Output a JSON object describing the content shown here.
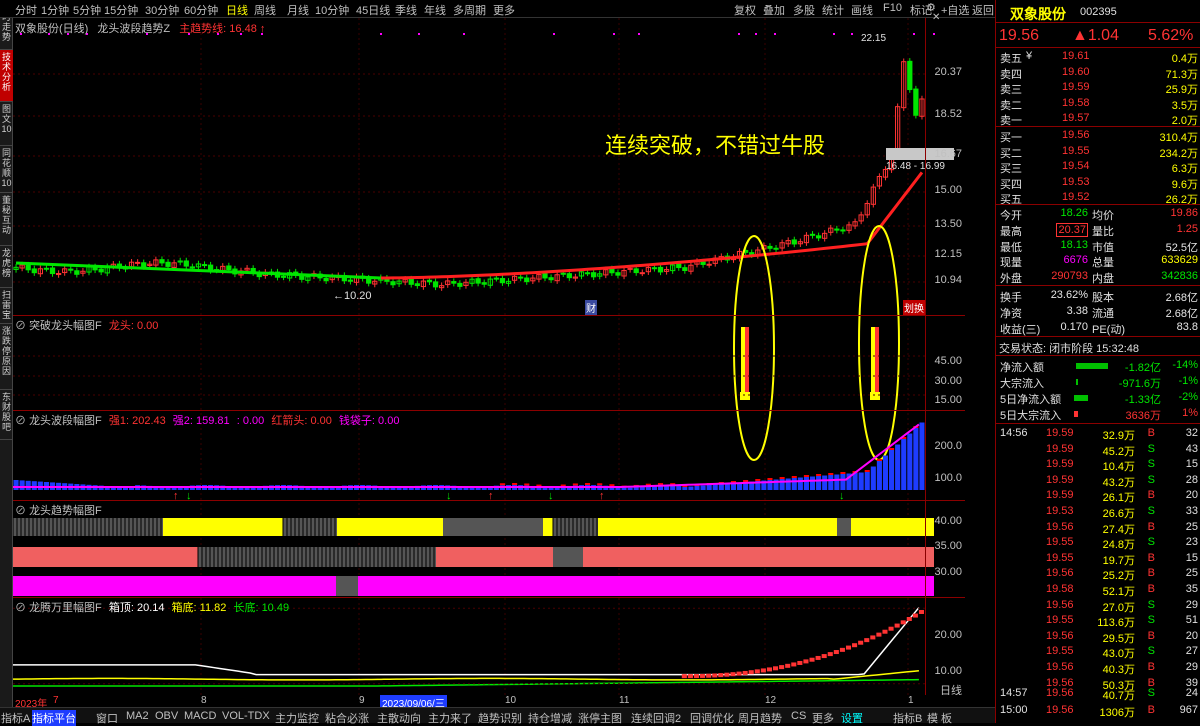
{
  "toolbar": {
    "periods": [
      "分时",
      "1分钟",
      "5分钟",
      "15分钟",
      "30分钟",
      "60分钟",
      "日线",
      "周线",
      "月线",
      "10分钟",
      "45日线",
      "季线",
      "年线",
      "多周期",
      "更多"
    ],
    "active_period": "日线",
    "right_tools": [
      "复权",
      "叠加",
      "多股",
      "统计",
      "画线",
      "F10",
      "标记"
    ],
    "self_select": "+自选",
    "back": "返回",
    "settings_icon": "gear-icon",
    "close_icon": "close-icon"
  },
  "leftnav": [
    "分时走势",
    "技术分析",
    "图文10",
    "同花顺10",
    "董秘互动",
    "龙虎榜",
    "扫雷宝",
    "涨跌停原因",
    "东财股吧"
  ],
  "leftnav_active": "技术分析",
  "main_pane": {
    "stock": "双象股份(日线)",
    "indicator": "龙头波段趋势Z",
    "trend_label": "主趋势线: 16.48",
    "annotation": "连续突破，不错过牛股",
    "high_label": "22.15",
    "low_label": "10.20",
    "range_label": "16.48 - 16.99",
    "axis": [
      "20.37",
      "18.52",
      "16.67",
      "15.00",
      "13.50",
      "12.15",
      "10.94"
    ],
    "marker_cai": "财",
    "marker_huan": "划换"
  },
  "pane2": {
    "name": "突破龙头幅图F",
    "label": "龙头: 0.00",
    "axis": [
      "45.00",
      "30.00",
      "15.00"
    ]
  },
  "pane3": {
    "name": "龙头波段幅图F",
    "q1": "强1: 202.43",
    "q2": "强2: 159.81",
    "colon": ": 0.00",
    "red_arrow": "红箭头: 0.00",
    "money_bag": "钱袋子: 0.00",
    "axis": [
      "200.0",
      "100.0"
    ]
  },
  "pane4": {
    "name": "龙头趋势幅图F",
    "axis": [
      "40.00",
      "35.00",
      "30.00"
    ]
  },
  "pane5": {
    "name": "龙腾万里幅图F",
    "top": "箱顶: 20.14",
    "bottom": "箱底: 11.82",
    "changdi": "长底: 10.49",
    "axis": [
      "20.00",
      "10.00"
    ],
    "axis_label": "日线"
  },
  "datebar": [
    {
      "text": "2023年",
      "color": "#ff3333"
    },
    {
      "text": "7",
      "color": "#ff3333"
    },
    {
      "text": "8",
      "color": "#c0c0c0"
    },
    {
      "text": "9",
      "color": "#c0c0c0"
    },
    {
      "text": "2023/09/06/三",
      "color": "#ffffff"
    },
    {
      "text": "10",
      "color": "#c0c0c0"
    },
    {
      "text": "11",
      "color": "#c0c0c0"
    },
    {
      "text": "12",
      "color": "#c0c0c0"
    },
    {
      "text": "1",
      "color": "#c0c0c0"
    }
  ],
  "bottombar": [
    "指标A",
    "指标平台",
    "窗口",
    "MA2",
    "OBV",
    "MACD",
    "VOL-TDX",
    "主力监控",
    "粘合必涨",
    "主散动向",
    "主力来了",
    "趋势识别",
    "持仓增减",
    "涨停主图",
    "连续回调2",
    "回调优化",
    "周月趋势",
    "CS",
    "更多",
    "设置"
  ],
  "bottombar_right": [
    "指标B",
    "模",
    "板"
  ],
  "quote": {
    "name": "双象股份",
    "code": "002395",
    "price": "19.56",
    "change": "▲1.04",
    "pct": "5.62%",
    "asks": [
      {
        "label": "卖五",
        "price": "19.61",
        "vol": "0.4万"
      },
      {
        "label": "卖四",
        "price": "19.60",
        "vol": "71.3万"
      },
      {
        "label": "卖三",
        "price": "19.59",
        "vol": "25.9万"
      },
      {
        "label": "卖二",
        "price": "19.58",
        "vol": "3.5万"
      },
      {
        "label": "卖一",
        "price": "19.57",
        "vol": "2.0万"
      }
    ],
    "ask_icon": "¥",
    "bids": [
      {
        "label": "买一",
        "price": "19.56",
        "vol": "310.4万"
      },
      {
        "label": "买二",
        "price": "19.55",
        "vol": "234.2万"
      },
      {
        "label": "买三",
        "price": "19.54",
        "vol": "6.3万"
      },
      {
        "label": "买四",
        "price": "19.53",
        "vol": "9.6万"
      },
      {
        "label": "买五",
        "price": "19.52",
        "vol": "26.2万"
      }
    ],
    "stats": [
      {
        "l1": "今开",
        "v1": "18.26",
        "c1": "green",
        "l2": "均价",
        "v2": "19.86",
        "c2": "red"
      },
      {
        "l1": "最高",
        "v1": "20.37",
        "c1": "red",
        "l2": "量比",
        "v2": "1.25",
        "c2": "red"
      },
      {
        "l1": "最低",
        "v1": "18.13",
        "c1": "green",
        "l2": "市值",
        "v2": "52.5亿",
        "c2": "white"
      },
      {
        "l1": "现量",
        "v1": "6676",
        "c1": "magenta",
        "l2": "总量",
        "v2": "633629",
        "c2": "yellow"
      },
      {
        "l1": "外盘",
        "v1": "290793",
        "c1": "red",
        "l2": "内盘",
        "v2": "342836",
        "c2": "green"
      }
    ],
    "stats2": [
      {
        "l1": "换手",
        "v1": "23.62%",
        "l2": "股本",
        "v2": "2.68亿"
      },
      {
        "l1": "净资",
        "v1": "3.38",
        "l2": "流通",
        "v2": "2.68亿"
      },
      {
        "l1": "收益(三)",
        "v1": "0.170",
        "l2": "PE(动)",
        "v2": "83.8"
      }
    ],
    "trade_status": "交易状态: 闭市阶段 15:32:48",
    "flows": [
      {
        "l": "净流入额",
        "v": "-1.82亿",
        "p": "-14%",
        "c": "green"
      },
      {
        "l": "大宗流入",
        "v": "-971.6万",
        "p": "-1%",
        "c": "green"
      },
      {
        "l": "5日净流入额",
        "v": "-1.33亿",
        "p": "-2%",
        "c": "green"
      },
      {
        "l": "5日大宗流入",
        "v": "3636万",
        "p": "1%",
        "c": "red"
      }
    ],
    "ticks": [
      {
        "t": "14:56",
        "p": "19.59",
        "v": "32.9万",
        "s": "B",
        "n": "32"
      },
      {
        "t": "",
        "p": "19.59",
        "v": "45.2万",
        "s": "S",
        "n": "43"
      },
      {
        "t": "",
        "p": "19.59",
        "v": "10.4万",
        "s": "S",
        "n": "15"
      },
      {
        "t": "",
        "p": "19.59",
        "v": "43.2万",
        "s": "S",
        "n": "28"
      },
      {
        "t": "",
        "p": "19.59",
        "v": "26.1万",
        "s": "B",
        "n": "20"
      },
      {
        "t": "",
        "p": "19.53",
        "v": "26.6万",
        "s": "S",
        "n": "33"
      },
      {
        "t": "",
        "p": "19.56",
        "v": "27.4万",
        "s": "B",
        "n": "25"
      },
      {
        "t": "",
        "p": "19.55",
        "v": "24.8万",
        "s": "S",
        "n": "23"
      },
      {
        "t": "",
        "p": "19.55",
        "v": "19.7万",
        "s": "B",
        "n": "15"
      },
      {
        "t": "",
        "p": "19.56",
        "v": "25.2万",
        "s": "B",
        "n": "25"
      },
      {
        "t": "",
        "p": "19.58",
        "v": "52.1万",
        "s": "B",
        "n": "35"
      },
      {
        "t": "",
        "p": "19.56",
        "v": "27.0万",
        "s": "S",
        "n": "29"
      },
      {
        "t": "",
        "p": "19.55",
        "v": "113.6万",
        "s": "S",
        "n": "51"
      },
      {
        "t": "",
        "p": "19.56",
        "v": "29.5万",
        "s": "B",
        "n": "20"
      },
      {
        "t": "",
        "p": "19.55",
        "v": "43.0万",
        "s": "S",
        "n": "27"
      },
      {
        "t": "",
        "p": "19.56",
        "v": "40.3万",
        "s": "B",
        "n": "29"
      },
      {
        "t": "",
        "p": "19.56",
        "v": "50.3万",
        "s": "B",
        "n": "39"
      },
      {
        "t": "14:57",
        "p": "19.56",
        "v": "40.7万",
        "s": "S",
        "n": "24"
      },
      {
        "t": "15:00",
        "p": "19.56",
        "v": "1306万",
        "s": "B",
        "n": "967"
      }
    ]
  },
  "colors": {
    "up": "#ff3333",
    "down": "#00e600",
    "border": "#8b0000",
    "accent_blue": "#1e3cff",
    "yellow": "#ffff00",
    "magenta": "#ff00ff"
  }
}
